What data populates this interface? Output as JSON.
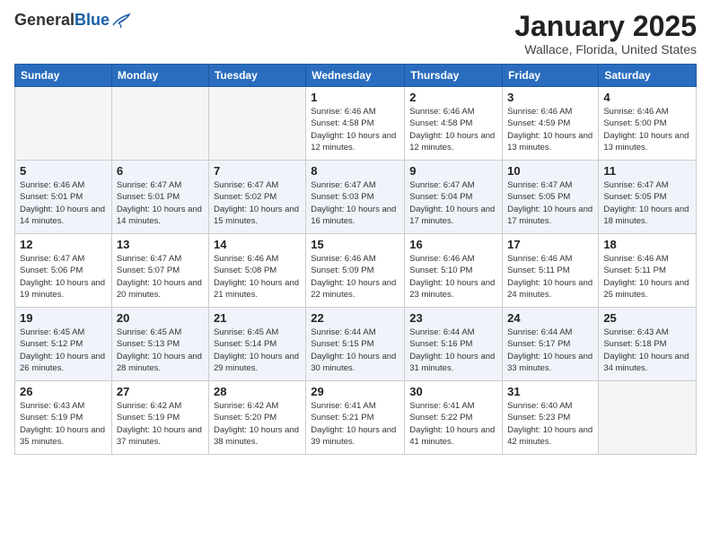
{
  "header": {
    "logo_general": "General",
    "logo_blue": "Blue",
    "month_title": "January 2025",
    "location": "Wallace, Florida, United States"
  },
  "weekdays": [
    "Sunday",
    "Monday",
    "Tuesday",
    "Wednesday",
    "Thursday",
    "Friday",
    "Saturday"
  ],
  "weeks": [
    [
      {
        "day": "",
        "empty": true
      },
      {
        "day": "",
        "empty": true
      },
      {
        "day": "",
        "empty": true
      },
      {
        "day": "1",
        "sunrise": "6:46 AM",
        "sunset": "4:58 PM",
        "daylight": "10 hours and 12 minutes."
      },
      {
        "day": "2",
        "sunrise": "6:46 AM",
        "sunset": "4:58 PM",
        "daylight": "10 hours and 12 minutes."
      },
      {
        "day": "3",
        "sunrise": "6:46 AM",
        "sunset": "4:59 PM",
        "daylight": "10 hours and 13 minutes."
      },
      {
        "day": "4",
        "sunrise": "6:46 AM",
        "sunset": "5:00 PM",
        "daylight": "10 hours and 13 minutes."
      }
    ],
    [
      {
        "day": "5",
        "sunrise": "6:46 AM",
        "sunset": "5:01 PM",
        "daylight": "10 hours and 14 minutes."
      },
      {
        "day": "6",
        "sunrise": "6:47 AM",
        "sunset": "5:01 PM",
        "daylight": "10 hours and 14 minutes."
      },
      {
        "day": "7",
        "sunrise": "6:47 AM",
        "sunset": "5:02 PM",
        "daylight": "10 hours and 15 minutes."
      },
      {
        "day": "8",
        "sunrise": "6:47 AM",
        "sunset": "5:03 PM",
        "daylight": "10 hours and 16 minutes."
      },
      {
        "day": "9",
        "sunrise": "6:47 AM",
        "sunset": "5:04 PM",
        "daylight": "10 hours and 17 minutes."
      },
      {
        "day": "10",
        "sunrise": "6:47 AM",
        "sunset": "5:05 PM",
        "daylight": "10 hours and 17 minutes."
      },
      {
        "day": "11",
        "sunrise": "6:47 AM",
        "sunset": "5:05 PM",
        "daylight": "10 hours and 18 minutes."
      }
    ],
    [
      {
        "day": "12",
        "sunrise": "6:47 AM",
        "sunset": "5:06 PM",
        "daylight": "10 hours and 19 minutes."
      },
      {
        "day": "13",
        "sunrise": "6:47 AM",
        "sunset": "5:07 PM",
        "daylight": "10 hours and 20 minutes."
      },
      {
        "day": "14",
        "sunrise": "6:46 AM",
        "sunset": "5:08 PM",
        "daylight": "10 hours and 21 minutes."
      },
      {
        "day": "15",
        "sunrise": "6:46 AM",
        "sunset": "5:09 PM",
        "daylight": "10 hours and 22 minutes."
      },
      {
        "day": "16",
        "sunrise": "6:46 AM",
        "sunset": "5:10 PM",
        "daylight": "10 hours and 23 minutes."
      },
      {
        "day": "17",
        "sunrise": "6:46 AM",
        "sunset": "5:11 PM",
        "daylight": "10 hours and 24 minutes."
      },
      {
        "day": "18",
        "sunrise": "6:46 AM",
        "sunset": "5:11 PM",
        "daylight": "10 hours and 25 minutes."
      }
    ],
    [
      {
        "day": "19",
        "sunrise": "6:45 AM",
        "sunset": "5:12 PM",
        "daylight": "10 hours and 26 minutes."
      },
      {
        "day": "20",
        "sunrise": "6:45 AM",
        "sunset": "5:13 PM",
        "daylight": "10 hours and 28 minutes."
      },
      {
        "day": "21",
        "sunrise": "6:45 AM",
        "sunset": "5:14 PM",
        "daylight": "10 hours and 29 minutes."
      },
      {
        "day": "22",
        "sunrise": "6:44 AM",
        "sunset": "5:15 PM",
        "daylight": "10 hours and 30 minutes."
      },
      {
        "day": "23",
        "sunrise": "6:44 AM",
        "sunset": "5:16 PM",
        "daylight": "10 hours and 31 minutes."
      },
      {
        "day": "24",
        "sunrise": "6:44 AM",
        "sunset": "5:17 PM",
        "daylight": "10 hours and 33 minutes."
      },
      {
        "day": "25",
        "sunrise": "6:43 AM",
        "sunset": "5:18 PM",
        "daylight": "10 hours and 34 minutes."
      }
    ],
    [
      {
        "day": "26",
        "sunrise": "6:43 AM",
        "sunset": "5:19 PM",
        "daylight": "10 hours and 35 minutes."
      },
      {
        "day": "27",
        "sunrise": "6:42 AM",
        "sunset": "5:19 PM",
        "daylight": "10 hours and 37 minutes."
      },
      {
        "day": "28",
        "sunrise": "6:42 AM",
        "sunset": "5:20 PM",
        "daylight": "10 hours and 38 minutes."
      },
      {
        "day": "29",
        "sunrise": "6:41 AM",
        "sunset": "5:21 PM",
        "daylight": "10 hours and 39 minutes."
      },
      {
        "day": "30",
        "sunrise": "6:41 AM",
        "sunset": "5:22 PM",
        "daylight": "10 hours and 41 minutes."
      },
      {
        "day": "31",
        "sunrise": "6:40 AM",
        "sunset": "5:23 PM",
        "daylight": "10 hours and 42 minutes."
      },
      {
        "day": "",
        "empty": true
      }
    ]
  ]
}
